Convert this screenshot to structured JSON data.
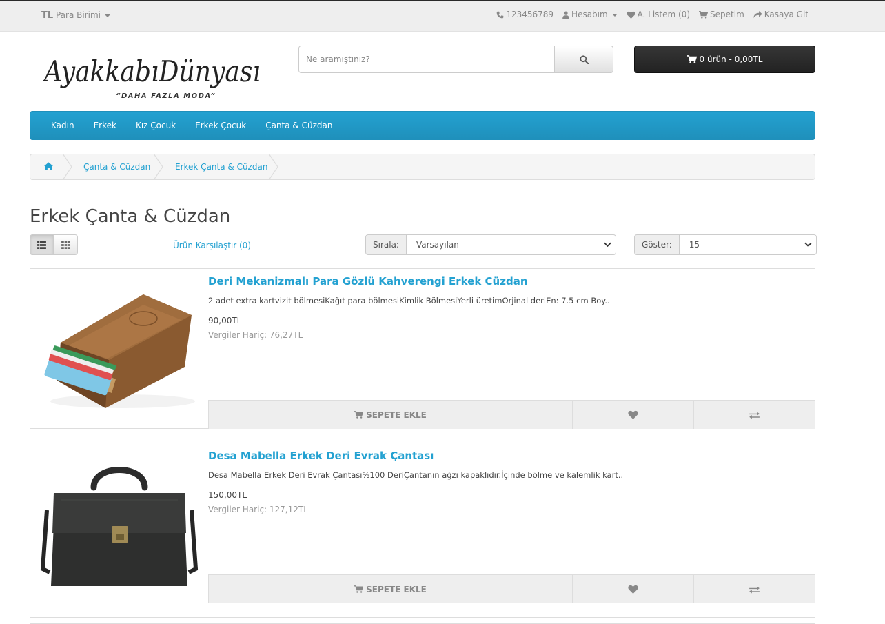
{
  "top": {
    "currency_symbol": "TL",
    "currency_label": "Para Birimi",
    "phone": "123456789",
    "account": "Hesabım",
    "wishlist": "A. Listem (0)",
    "cart": "Sepetim",
    "checkout": "Kasaya Git"
  },
  "logo": {
    "text": "AyakkabıDünyası",
    "slogan": "“DAHA FAZLA MODA”"
  },
  "search": {
    "placeholder": "Ne aramıştınız?"
  },
  "cart_button": {
    "label": "0 ürün - 0,00TL"
  },
  "menu": {
    "items": [
      "Kadın",
      "Erkek",
      "Kız Çocuk",
      "Erkek Çocuk",
      "Çanta & Cüzdan"
    ]
  },
  "breadcrumb": {
    "items": [
      "Çanta & Cüzdan",
      "Erkek Çanta & Cüzdan"
    ]
  },
  "page": {
    "title": "Erkek Çanta & Cüzdan",
    "compare_link": "Ürün Karşılaştır (0)",
    "sort_label": "Sırala:",
    "sort_value": "Varsayılan",
    "limit_label": "Göster:",
    "limit_value": "15"
  },
  "products": [
    {
      "name": "Deri Mekanizmalı Para Gözlü Kahverengi Erkek Cüzdan",
      "description": "2 adet extra kartvizit bölmesiKağıt para bölmesiKimlik BölmesiYerli üretimOrjinal deriEn: 7.5 cm Boy..",
      "price": "90,00TL",
      "tax": "Vergiler Hariç: 76,27TL",
      "cart_label": "SEPETE EKLE"
    },
    {
      "name": "Desa Mabella Erkek Deri Evrak Çantası",
      "description": "Desa Mabella Erkek Deri Evrak Çantası%100 DeriÇantanın ağzı kapaklıdır.İçinde bölme ve kalemlik kart..",
      "price": "150,00TL",
      "tax": "Vergiler Hariç: 127,12TL",
      "cart_label": "SEPETE EKLE"
    }
  ],
  "colors": {
    "accent": "#23a1d1",
    "dark_button": "#2b2b2b",
    "top_bar": "#eeeeee"
  },
  "icons": [
    "phone-icon",
    "user-icon",
    "heart-icon",
    "cart-icon",
    "share-icon",
    "search-icon",
    "home-icon",
    "list-icon",
    "grid-icon",
    "compare-icon",
    "chevron-down-icon"
  ]
}
